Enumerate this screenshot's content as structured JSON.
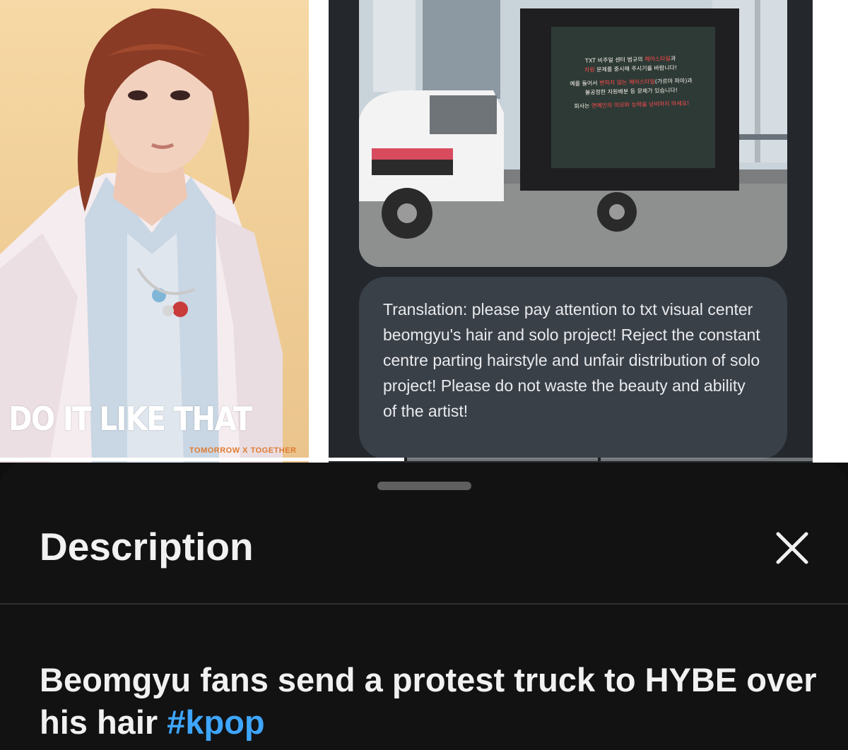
{
  "video": {
    "poster": {
      "title": "DO IT LIKE THAT",
      "subtitle": "TOMORROW X TOGETHER"
    },
    "screen_lines": {
      "line1a": "TXT 비주얼 센터 범규의 ",
      "line1b": "헤어스타일",
      "line1c": "과",
      "line2a": "자원",
      "line2b": " 문제를 중시해 주시기를 바랍니다!",
      "line3a": "예를 들어서 ",
      "line3b": "변하지 않는 헤어스타일",
      "line3c": "(가르마 파마)과",
      "line4": "불공정한 자원배분 등 문제가 있습니다!",
      "line5a": "회사는 ",
      "line5b": "연예인의 미모와 능력을 낭비하지 마세요!"
    },
    "translation": "Translation: please pay attention to txt visual center beomgyu's hair and solo project! Reject the constant centre parting hairstyle and unfair distribution of solo project! Please do not waste the beauty and ability of the artist!",
    "progress": 0.48
  },
  "description_panel": {
    "header": "Description",
    "close_icon": "close-icon",
    "video_title": "Beomgyu fans send a protest truck to HYBE over his hair ",
    "hashtag": "#kpop",
    "colors": {
      "background": "#121212",
      "hashtag": "#3ea6ff",
      "text": "#f1f1f1"
    }
  }
}
